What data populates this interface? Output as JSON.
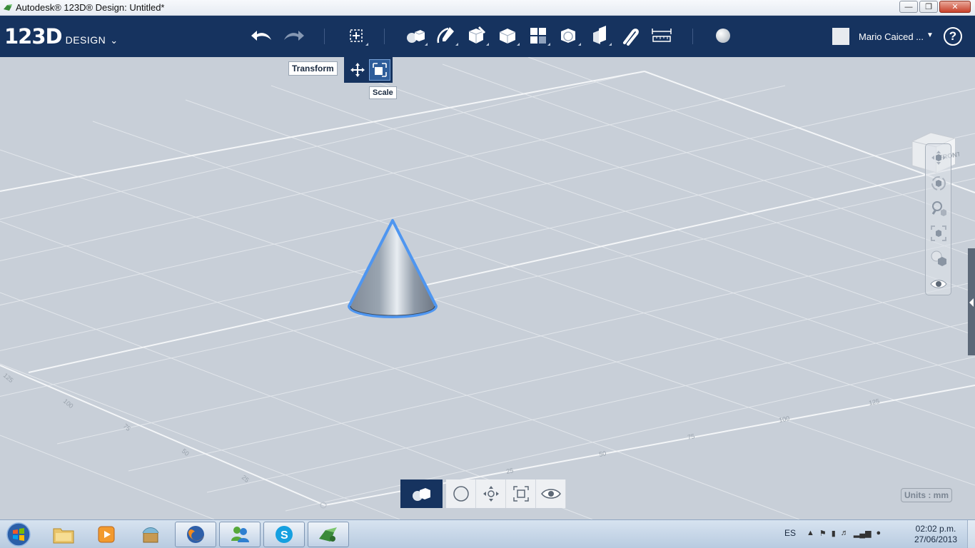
{
  "window": {
    "title": "Autodesk® 123D® Design: Untitled*",
    "controls": [
      "minimize",
      "maximize",
      "close"
    ]
  },
  "toolbar": {
    "brand_num": "123D",
    "brand_word": "DESIGN",
    "tools": [
      {
        "name": "undo-icon"
      },
      {
        "name": "redo-icon"
      },
      {
        "name": "transform-icon"
      },
      {
        "name": "primitives-icon"
      },
      {
        "name": "sketch-icon"
      },
      {
        "name": "construct-icon"
      },
      {
        "name": "modify-icon"
      },
      {
        "name": "pattern-icon"
      },
      {
        "name": "group-icon"
      },
      {
        "name": "combine-icon"
      },
      {
        "name": "snap-icon"
      },
      {
        "name": "measure-icon"
      },
      {
        "name": "material-icon"
      }
    ],
    "user_name": "Mario Caiced ...",
    "help_label": "?"
  },
  "transform_popup": {
    "tooltip_transform": "Transform",
    "tooltip_scale": "Scale"
  },
  "viewcube": {
    "label": "FRONT"
  },
  "navbar": {
    "items": [
      "pan-icon",
      "orbit-icon",
      "zoom-icon",
      "fit-icon",
      "material-view-icon",
      "visibility-icon"
    ]
  },
  "modebar": {
    "items": [
      "solid-mode-icon",
      "sphere-mode-icon",
      "move-mode-icon",
      "scale-mode-icon",
      "view-mode-icon"
    ]
  },
  "units": "Units : mm",
  "grid_labels": [
    "125",
    "100",
    "75",
    "50",
    "25",
    "25",
    "50",
    "75",
    "100",
    "125"
  ],
  "taskbar": {
    "tray_lang": "ES",
    "time": "02:02 p.m.",
    "date": "27/06/2013"
  },
  "colors": {
    "toolbar_bg": "#16335f",
    "viewport_bg": "#c8cfd8",
    "selection": "#4f96f0"
  }
}
